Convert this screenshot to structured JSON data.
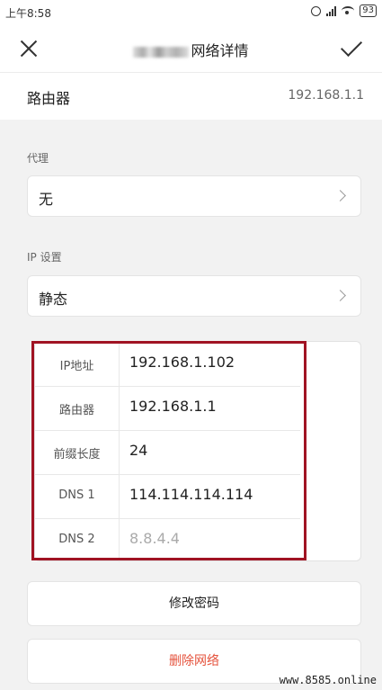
{
  "status_bar": {
    "time": "上午8:58",
    "battery": "93"
  },
  "header": {
    "title": "网络详情"
  },
  "router_row": {
    "label": "路由器",
    "value": "192.168.1.1"
  },
  "proxy": {
    "label": "代理",
    "value": "无"
  },
  "ip_settings": {
    "label": "IP 设置",
    "value": "静态"
  },
  "ip_config": [
    {
      "label": "IP地址",
      "value": "192.168.1.102",
      "placeholder": false
    },
    {
      "label": "路由器",
      "value": "192.168.1.1",
      "placeholder": false
    },
    {
      "label": "前缀长度",
      "value": "24",
      "placeholder": false
    },
    {
      "label": "DNS 1",
      "value": "114.114.114.114",
      "placeholder": false
    },
    {
      "label": "DNS 2",
      "value": "8.8.4.4",
      "placeholder": true
    }
  ],
  "actions": {
    "modify_password": {
      "label": "修改密码",
      "color": "#222222"
    },
    "delete_network": {
      "label": "删除网络",
      "color": "#e5533d"
    }
  },
  "highlight_color": "#a01323",
  "watermark": "www.8585.online"
}
